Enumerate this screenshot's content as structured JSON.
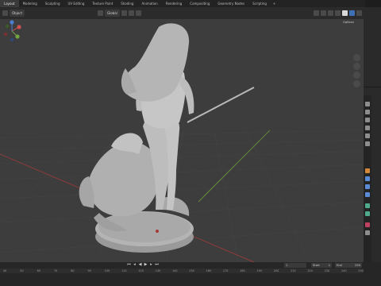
{
  "workspace_tabs": [
    "Layout",
    "Modeling",
    "Sculpting",
    "UV Editing",
    "Texture Paint",
    "Shading",
    "Animation",
    "Rendering",
    "Compositing",
    "Geometry Nodes",
    "Scripting"
  ],
  "active_tab": "Layout",
  "viewport_header": {
    "object_mode": "Object",
    "transform_orientation": "Global",
    "options_label": "Options"
  },
  "gizmo_axes": {
    "x": "X",
    "y": "Y",
    "z": "Z"
  },
  "timeline": {
    "current_frame": "1",
    "start_label": "Start",
    "start_value": "1",
    "end_label": "End",
    "end_value": "250",
    "ruler_ticks": [
      "40",
      "50",
      "60",
      "70",
      "80",
      "90",
      "100",
      "110",
      "120",
      "130",
      "140",
      "150",
      "160",
      "170",
      "180",
      "190",
      "200",
      "210",
      "220",
      "230",
      "240",
      "250"
    ]
  },
  "colors": {
    "viewport_bg": "#3d3d3d",
    "axis_red": "#a43a3a",
    "axis_green": "#6e9a3a",
    "accent_blue": "#3f6fb5",
    "model": "#b9b9b9"
  }
}
